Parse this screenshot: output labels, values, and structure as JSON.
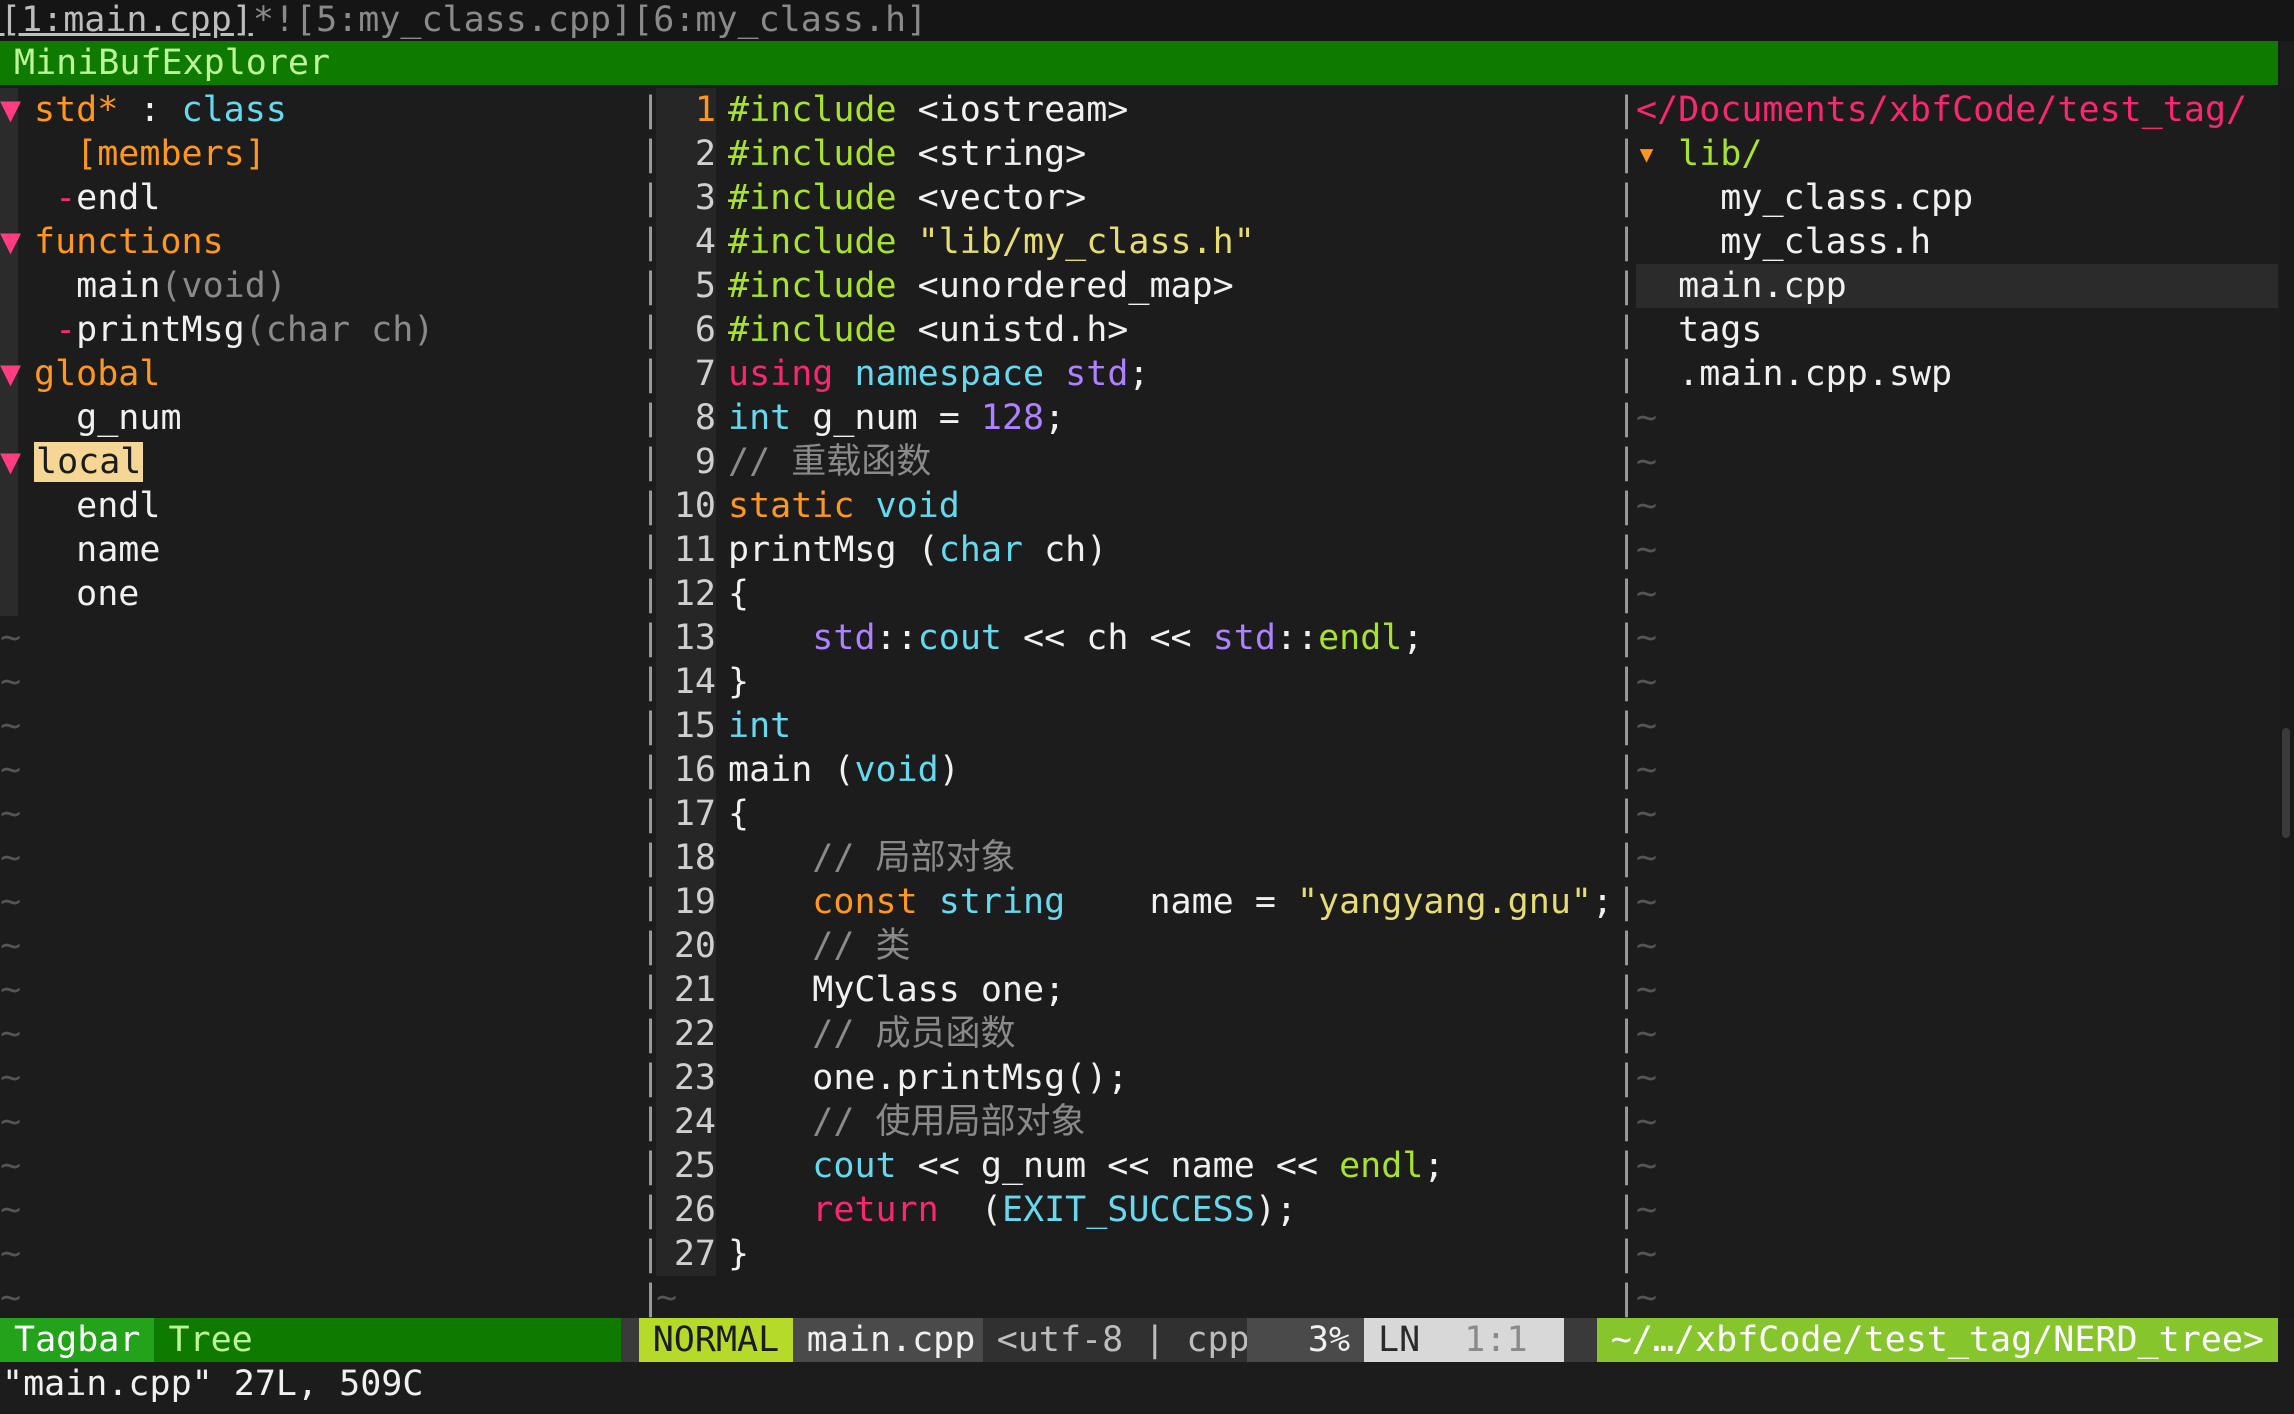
{
  "buffer_bar": {
    "active": "[1:main.cpp]",
    "active_flags": "*!",
    "others": "[5:my_class.cpp][6:my_class.h]"
  },
  "minibuf_title": "MiniBufExplorer",
  "tagbar": {
    "std_name": "std*",
    "std_sep": " : ",
    "std_kind": "class",
    "members": "[members]",
    "endl_member": "endl",
    "functions_header": "functions",
    "main_fn": "main",
    "main_sig": "(void)",
    "print_fn": "printMsg",
    "print_sig": "(char ch)",
    "global_header": "global",
    "g_num": "g_num",
    "local_header": "local",
    "local_endl": "endl",
    "local_name": "name",
    "local_one": "one",
    "tilde_count": 16
  },
  "editor": {
    "lines": [
      {
        "n": "1",
        "t": "#include <iostream>"
      },
      {
        "n": "2",
        "t": "#include <string>"
      },
      {
        "n": "3",
        "t": "#include <vector>"
      },
      {
        "n": "4",
        "t": "#include \"lib/my_class.h\""
      },
      {
        "n": "5",
        "t": "#include <unordered_map>"
      },
      {
        "n": "6",
        "t": "#include <unistd.h>"
      },
      {
        "n": "7",
        "t": "using namespace std;"
      },
      {
        "n": "8",
        "t": "int g_num = 128;"
      },
      {
        "n": "9",
        "t": "// 重载函数"
      },
      {
        "n": "10",
        "t": "static void"
      },
      {
        "n": "11",
        "t": "printMsg (char ch)"
      },
      {
        "n": "12",
        "t": "{"
      },
      {
        "n": "13",
        "t": "    std::cout << ch << std::endl;"
      },
      {
        "n": "14",
        "t": "}"
      },
      {
        "n": "15",
        "t": "int"
      },
      {
        "n": "16",
        "t": "main (void)"
      },
      {
        "n": "17",
        "t": "{"
      },
      {
        "n": "18",
        "t": "    // 局部对象"
      },
      {
        "n": "19",
        "t": "    const string    name = \"yangyang.gnu\";"
      },
      {
        "n": "20",
        "t": "    // 类"
      },
      {
        "n": "21",
        "t": "    MyClass one;"
      },
      {
        "n": "22",
        "t": "    // 成员函数"
      },
      {
        "n": "23",
        "t": "    one.printMsg();"
      },
      {
        "n": "24",
        "t": "    // 使用局部对象"
      },
      {
        "n": "25",
        "t": "    cout << g_num << name << endl;"
      },
      {
        "n": "26",
        "t": "    return  (EXIT_SUCCESS);"
      },
      {
        "n": "27",
        "t": "}"
      }
    ]
  },
  "tree": {
    "root_path": "</Documents/xbfCode/test_tag/",
    "lib_dir": "lib/",
    "lib_file1": "my_class.cpp",
    "lib_file2": "my_class.h",
    "file_main": "main.cpp",
    "file_tags": "tags",
    "file_swp": ".main.cpp.swp",
    "tilde_count": 22
  },
  "statusline": {
    "tagbar": "Tagbar",
    "tree": "Tree",
    "mode": "NORMAL",
    "file": "main.cpp",
    "info": "<utf-8 | cpp",
    "percent": "3%",
    "ln_label": "LN",
    "position": "1:1",
    "nerd_path": "~/…/xbfCode/test_tag/NERD_tree>"
  },
  "cmdline": "\"main.cpp\" 27L, 509C",
  "colors": {
    "keyword_orange": "#fd9720",
    "type_blue": "#66d9ef",
    "keyword_pink": "#f92672",
    "green": "#a6e22e",
    "purple": "#ae81ff",
    "string_yellow": "#e6db74",
    "minibuf_green": "#0e7a00"
  }
}
